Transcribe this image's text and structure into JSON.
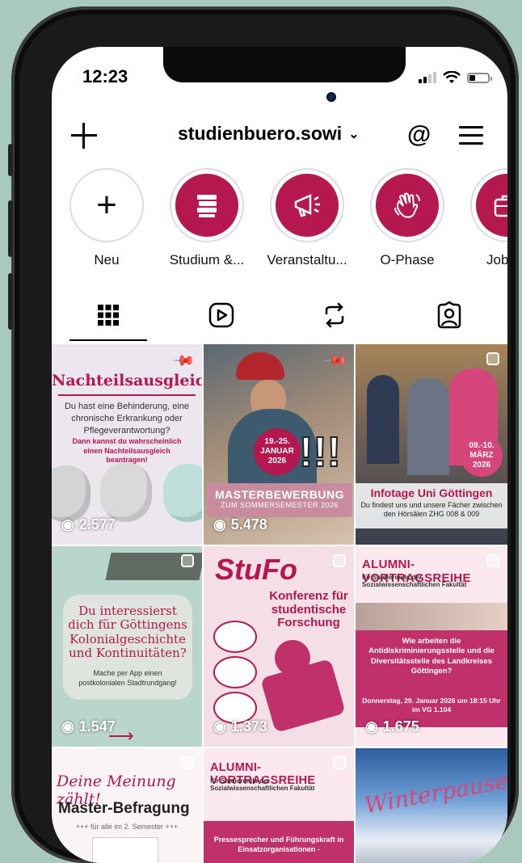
{
  "status": {
    "time": "12:23"
  },
  "header": {
    "username": "studienbuero.sowi"
  },
  "highlights": [
    {
      "label": "Neu"
    },
    {
      "label": "Studium &..."
    },
    {
      "label": "Veranstaltu..."
    },
    {
      "label": "O-Phase"
    },
    {
      "label": "Jobs &"
    }
  ],
  "tabs": [
    {
      "icon": "grid-icon"
    },
    {
      "icon": "reels-icon"
    },
    {
      "icon": "reposts-icon"
    },
    {
      "icon": "tagged-icon"
    }
  ],
  "colors": {
    "brand": "#b5174f",
    "background": "#a9c9bd"
  },
  "posts": [
    {
      "title": "Nachteilsausgleich",
      "text": "Du hast eine Behinderung, eine chronische Erkrankung oder Pflegeverantwortung?",
      "subtext": "Dann kannst du wahrscheinlich einen Nachteilsausgleich beantragen!",
      "views": "2.577"
    },
    {
      "title": "MASTERBEWERBUNG",
      "subtitle": "ZUM SOMMERSEMESTER 2026",
      "date": "19.-25. JANUAR 2026",
      "views": "5.478"
    },
    {
      "title": "Infotage Uni Göttingen",
      "text": "Du findest uns und unsere Fächer zwischen den Hörsälen ZHG 008 & 009",
      "date": "09.-10. MÄRZ 2026"
    },
    {
      "title": "Du interessierst dich für Göttingens Kolonialgeschichte und Kontinuitäten?",
      "text": "Mache per App einen postkolonialen Stadtrundgang!",
      "views": "1.547"
    },
    {
      "title": "StuFo",
      "subtitle": "Konferenz für studentische Forschung",
      "views": "1.373"
    },
    {
      "title": "ALUMNI- VORTRAGSREIHE",
      "subtitle": "für Studierende der Sozialwissenschaftlichen Fakultät",
      "text": "Wie arbeiten die Antidiskriminierungsstelle und die Diversitätsstelle des Landkreises Göttingen?",
      "date": "Donnerstag, 29. Januar 2026 um 18:15 Uhr im VG 1.104",
      "views": "1.675"
    },
    {
      "title": "Deine Meinung zählt!",
      "subtitle": "Master-Befragung",
      "text": "+++ für alle im 2. Semester +++"
    },
    {
      "title": "ALUMNI- VORTRAGSREIHE",
      "subtitle": "für Studierende der Sozialwissenschaftlichen Fakultät",
      "text": "Pressesprecher und Führungskraft in Einsatzorganisationen -"
    },
    {
      "title": "Winterpause"
    }
  ]
}
